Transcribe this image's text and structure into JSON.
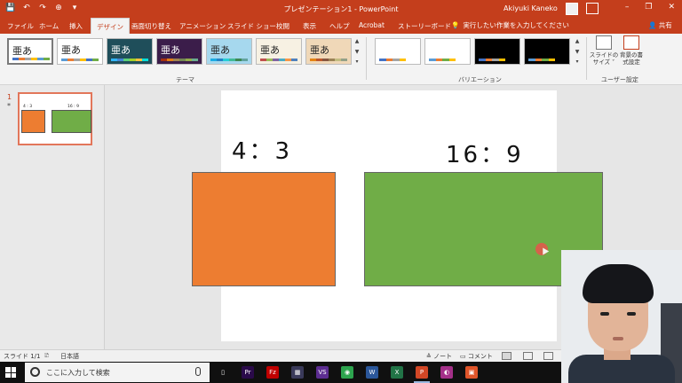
{
  "app": {
    "title": "プレゼンテーション1 - PowerPoint",
    "user": "Akiyuki Kaneko",
    "brand_color": "#c43e1c"
  },
  "window_controls": {
    "minimize": "–",
    "restore": "❐",
    "close": "✕"
  },
  "qat": {
    "save_icon": "💾",
    "undo_icon": "↶",
    "redo_icon": "↷",
    "start_icon": "⊕",
    "customize_icon": "▾"
  },
  "tabs": [
    {
      "label": "ファイル"
    },
    {
      "label": "ホーム"
    },
    {
      "label": "挿入"
    },
    {
      "label": "デザイン",
      "active": true
    },
    {
      "label": "画面切り替え"
    },
    {
      "label": "アニメーション"
    },
    {
      "label": "スライド ショー"
    },
    {
      "label": "校閲"
    },
    {
      "label": "表示"
    },
    {
      "label": "ヘルプ"
    },
    {
      "label": "Acrobat"
    },
    {
      "label": "ストーリーボード"
    }
  ],
  "tell_me": {
    "icon": "💡",
    "text": "実行したい作業を入力してください"
  },
  "share": {
    "label": "共有",
    "icon": "👤"
  },
  "ribbon": {
    "themes": [
      {
        "label": "亜あ",
        "bg": "#ffffff",
        "fg": "#222222",
        "bars": [
          "#4472c4",
          "#ed7d31",
          "#a5a5a5",
          "#ffc000",
          "#5b9bd5",
          "#70ad47"
        ]
      },
      {
        "label": "亜あ",
        "bg": "#ffffff",
        "fg": "#222222",
        "bars": [
          "#5b9bd5",
          "#ed7d31",
          "#a5a5a5",
          "#ffc000",
          "#4472c4",
          "#70ad47"
        ]
      },
      {
        "label": "亜あ",
        "bg": "#1f4e5a",
        "fg": "#ffffff",
        "bars": [
          "#31b6fd",
          "#4584d3",
          "#5bd078",
          "#a5d028",
          "#f5c040",
          "#05e0db"
        ]
      },
      {
        "label": "亜あ",
        "bg": "#3b1d4a",
        "fg": "#ffffff",
        "bars": [
          "#a53010",
          "#de7e18",
          "#9f8351",
          "#728653",
          "#92aa4c",
          "#6aac91"
        ]
      },
      {
        "label": "亜あ",
        "bg": "#a6d8ee",
        "fg": "#222222",
        "bars": [
          "#1cade4",
          "#2683c6",
          "#27ced7",
          "#42ba97",
          "#3e8853",
          "#62a39f"
        ]
      },
      {
        "label": "亜あ",
        "bg": "#f7f1e3",
        "fg": "#222222",
        "bars": [
          "#c0504d",
          "#9bbb59",
          "#8064a2",
          "#4bacc6",
          "#f79646",
          "#4f81bd"
        ]
      },
      {
        "label": "亜あ",
        "bg": "#f0d8b8",
        "fg": "#222222",
        "bars": [
          "#e48312",
          "#bd582c",
          "#865640",
          "#9b8357",
          "#c2bc80",
          "#94a088"
        ]
      }
    ],
    "theme_group_label": "テーマ",
    "variants": [
      {
        "bg": "#ffffff",
        "bars": [
          "#4472c4",
          "#ed7d31",
          "#a5a5a5",
          "#ffc000"
        ]
      },
      {
        "bg": "#ffffff",
        "bars": [
          "#5b9bd5",
          "#ed7d31",
          "#70ad47",
          "#ffc000"
        ]
      },
      {
        "bg": "#000000",
        "bars": [
          "#4472c4",
          "#ed7d31",
          "#a5a5a5",
          "#ffc000"
        ]
      },
      {
        "bg": "#000000",
        "bars": [
          "#5b9bd5",
          "#ed7d31",
          "#70ad47",
          "#ffc000"
        ]
      }
    ],
    "variant_group_label": "バリエーション",
    "slide_size_label": "スライドの\nサイズ ˅",
    "format_bg_label": "背景の書\n式設定",
    "customize_group_label": "ユーザー設定"
  },
  "thumbnail": {
    "number": "1",
    "star": "*",
    "left_label": "4 : 3",
    "right_label": "16 : 9"
  },
  "slide": {
    "label_43": "4：3",
    "label_169": "16：9",
    "orange": "#ed7d31",
    "green": "#70ad47"
  },
  "statusbar": {
    "slide_info": "スライド 1/1",
    "language": "日本語",
    "notes": "≙ ノート",
    "comments": "▭ コメント"
  },
  "taskbar": {
    "search_placeholder": "ここに入力して検索",
    "apps": [
      {
        "name": "task-view",
        "glyph": "▯",
        "color": "#101010"
      },
      {
        "name": "premiere",
        "glyph": "Pr",
        "color": "#2a0a4a"
      },
      {
        "name": "filezilla",
        "glyph": "Fz",
        "color": "#bf0000"
      },
      {
        "name": "xd",
        "glyph": "▦",
        "color": "#3a3a5a"
      },
      {
        "name": "visual-studio",
        "glyph": "VS",
        "color": "#5c2d91"
      },
      {
        "name": "chrome",
        "glyph": "◉",
        "color": "#2da44e"
      },
      {
        "name": "word",
        "glyph": "W",
        "color": "#2b579a"
      },
      {
        "name": "excel",
        "glyph": "X",
        "color": "#217346"
      },
      {
        "name": "powerpoint",
        "glyph": "P",
        "color": "#d24726",
        "active": true
      },
      {
        "name": "app-pink",
        "glyph": "◐",
        "color": "#a43089"
      },
      {
        "name": "app-orange",
        "glyph": "▣",
        "color": "#e0552a"
      }
    ]
  }
}
